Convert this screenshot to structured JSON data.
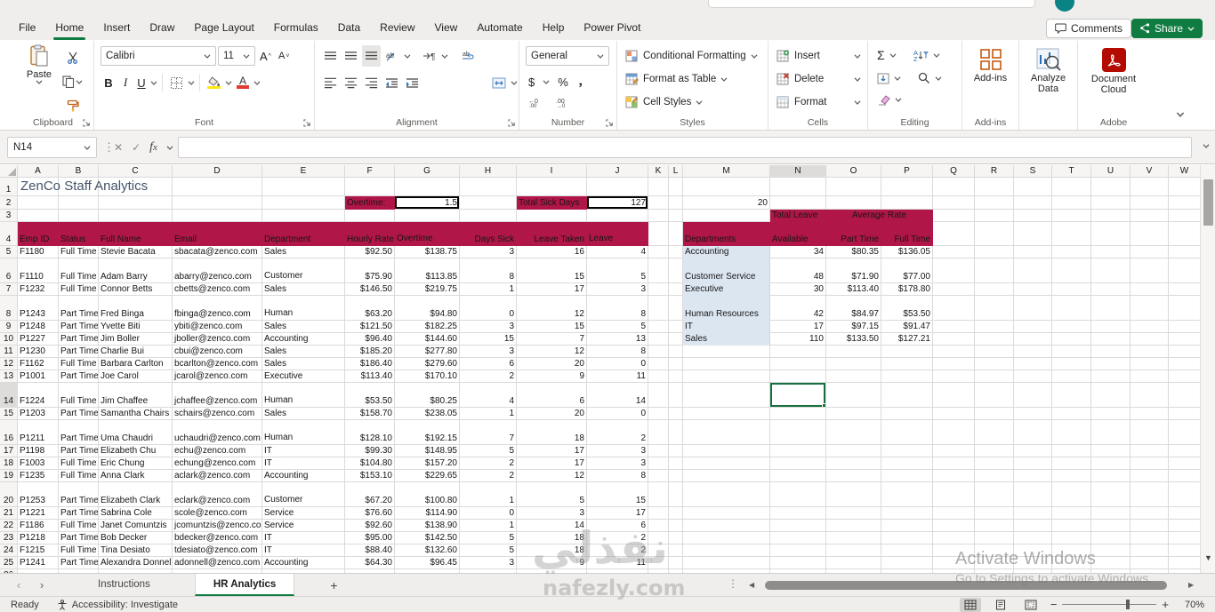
{
  "titlebar": {
    "avatar": "user-avatar"
  },
  "ribbon_tabs": {
    "items": [
      "File",
      "Home",
      "Insert",
      "Draw",
      "Page Layout",
      "Formulas",
      "Data",
      "Review",
      "View",
      "Automate",
      "Help",
      "Power Pivot"
    ],
    "active": "Home"
  },
  "actions": {
    "comments": "Comments",
    "share": "Share"
  },
  "ribbon": {
    "clipboard": {
      "label": "Clipboard",
      "paste": "Paste"
    },
    "font": {
      "label": "Font",
      "font_name": "Calibri",
      "font_size": "11"
    },
    "alignment": {
      "label": "Alignment"
    },
    "number": {
      "label": "Number",
      "format": "General"
    },
    "styles": {
      "label": "Styles",
      "items": [
        "Conditional Formatting",
        "Format as Table",
        "Cell Styles"
      ]
    },
    "cells": {
      "label": "Cells",
      "items": [
        "Insert",
        "Delete",
        "Format"
      ]
    },
    "editing": {
      "label": "Editing"
    },
    "addins": {
      "label": "Add-ins",
      "button": "Add-ins"
    },
    "analyze": {
      "button": "Analyze Data"
    },
    "adobe": {
      "label": "Adobe",
      "button": "Document Cloud"
    }
  },
  "formula_bar": {
    "name_box": "N14",
    "formula": ""
  },
  "sheet": {
    "columns": [
      "A",
      "B",
      "C",
      "D",
      "E",
      "F",
      "G",
      "H",
      "I",
      "J",
      "K",
      "L",
      "M",
      "N",
      "O",
      "P",
      "Q",
      "R",
      "S",
      "T",
      "U",
      "V",
      "W"
    ],
    "title": "ZenCo Staff Analytics",
    "overtime_label": "Overtime:",
    "overtime_value": "1.5",
    "sick_label": "Total Sick Days",
    "sick_value": "127",
    "m2_value": "20",
    "selected_cell": "N14",
    "table_headers": [
      {
        "col": "A",
        "label": "Emp ID",
        "align": "left"
      },
      {
        "col": "B",
        "label": "Status",
        "align": "left"
      },
      {
        "col": "C",
        "label": "Full Name",
        "align": "left"
      },
      {
        "col": "D",
        "label": "Email",
        "align": "left"
      },
      {
        "col": "E",
        "label": "Department",
        "align": "left"
      },
      {
        "col": "F",
        "label": "Hourly Rate",
        "align": "right"
      },
      {
        "col": "G",
        "label": "Overtime Rate",
        "align": "right",
        "wrap": true
      },
      {
        "col": "H",
        "label": "Days Sick",
        "align": "right"
      },
      {
        "col": "I",
        "label": "Leave Taken",
        "align": "right"
      },
      {
        "col": "J",
        "label": "Leave Available",
        "align": "right",
        "wrap": true
      }
    ],
    "employees": [
      {
        "emp_id": "F1180",
        "status": "Full Time",
        "full_name": "Stevie Bacata",
        "email": "sbacata@zenco.com",
        "department": "Sales",
        "hourly_rate": "$92.50",
        "overtime_rate": "$138.75",
        "days_sick": "3",
        "leave_taken": "16",
        "leave_available": "4"
      },
      {
        "emp_id": "F1110",
        "status": "Full Time",
        "full_name": "Adam Barry",
        "email": "abarry@zenco.com",
        "department": "Customer Service",
        "hourly_rate": "$75.90",
        "overtime_rate": "$113.85",
        "days_sick": "8",
        "leave_taken": "15",
        "leave_available": "5"
      },
      {
        "emp_id": "F1232",
        "status": "Full Time",
        "full_name": "Connor Betts",
        "email": "cbetts@zenco.com",
        "department": "Sales",
        "hourly_rate": "$146.50",
        "overtime_rate": "$219.75",
        "days_sick": "1",
        "leave_taken": "17",
        "leave_available": "3"
      },
      {
        "emp_id": "P1243",
        "status": "Part Time",
        "full_name": "Fred Binga",
        "email": "fbinga@zenco.com",
        "department": "Human Resources",
        "hourly_rate": "$63.20",
        "overtime_rate": "$94.80",
        "days_sick": "0",
        "leave_taken": "12",
        "leave_available": "8"
      },
      {
        "emp_id": "P1248",
        "status": "Part Time",
        "full_name": "Yvette Biti",
        "email": "ybiti@zenco.com",
        "department": "Sales",
        "hourly_rate": "$121.50",
        "overtime_rate": "$182.25",
        "days_sick": "3",
        "leave_taken": "15",
        "leave_available": "5"
      },
      {
        "emp_id": "P1227",
        "status": "Part Time",
        "full_name": "Jim Boller",
        "email": "jboller@zenco.com",
        "department": "Accounting",
        "hourly_rate": "$96.40",
        "overtime_rate": "$144.60",
        "days_sick": "15",
        "leave_taken": "7",
        "leave_available": "13"
      },
      {
        "emp_id": "P1230",
        "status": "Part Time",
        "full_name": "Charlie Bui",
        "email": "cbui@zenco.com",
        "department": "Sales",
        "hourly_rate": "$185.20",
        "overtime_rate": "$277.80",
        "days_sick": "3",
        "leave_taken": "12",
        "leave_available": "8"
      },
      {
        "emp_id": "F1162",
        "status": "Full Time",
        "full_name": "Barbara Carlton",
        "email": "bcarlton@zenco.com",
        "department": "Sales",
        "hourly_rate": "$186.40",
        "overtime_rate": "$279.60",
        "days_sick": "6",
        "leave_taken": "20",
        "leave_available": "0"
      },
      {
        "emp_id": "P1001",
        "status": "Part Time",
        "full_name": "Joe Carol",
        "email": "jcarol@zenco.com",
        "department": "Executive",
        "hourly_rate": "$113.40",
        "overtime_rate": "$170.10",
        "days_sick": "2",
        "leave_taken": "9",
        "leave_available": "11"
      },
      {
        "emp_id": "F1224",
        "status": "Full Time",
        "full_name": "Jim Chaffee",
        "email": "jchaffee@zenco.com",
        "department": "Human Resources",
        "hourly_rate": "$53.50",
        "overtime_rate": "$80.25",
        "days_sick": "4",
        "leave_taken": "6",
        "leave_available": "14"
      },
      {
        "emp_id": "P1203",
        "status": "Part Time",
        "full_name": "Samantha Chairs",
        "email": "schairs@zenco.com",
        "department": "Sales",
        "hourly_rate": "$158.70",
        "overtime_rate": "$238.05",
        "days_sick": "1",
        "leave_taken": "20",
        "leave_available": "0"
      },
      {
        "emp_id": "P1211",
        "status": "Part Time",
        "full_name": "Uma Chaudri",
        "email": "uchaudri@zenco.com",
        "department": "Human Resources",
        "hourly_rate": "$128.10",
        "overtime_rate": "$192.15",
        "days_sick": "7",
        "leave_taken": "18",
        "leave_available": "2"
      },
      {
        "emp_id": "P1198",
        "status": "Part Time",
        "full_name": "Elizabeth Chu",
        "email": "echu@zenco.com",
        "department": "IT",
        "hourly_rate": "$99.30",
        "overtime_rate": "$148.95",
        "days_sick": "5",
        "leave_taken": "17",
        "leave_available": "3"
      },
      {
        "emp_id": "F1003",
        "status": "Full Time",
        "full_name": "Eric Chung",
        "email": "echung@zenco.com",
        "department": "IT",
        "hourly_rate": "$104.80",
        "overtime_rate": "$157.20",
        "days_sick": "2",
        "leave_taken": "17",
        "leave_available": "3"
      },
      {
        "emp_id": "F1235",
        "status": "Full Time",
        "full_name": "Anna Clark",
        "email": "aclark@zenco.com",
        "department": "Accounting",
        "hourly_rate": "$153.10",
        "overtime_rate": "$229.65",
        "days_sick": "2",
        "leave_taken": "12",
        "leave_available": "8"
      },
      {
        "emp_id": "P1253",
        "status": "Part Time",
        "full_name": "Elizabeth Clark",
        "email": "eclark@zenco.com",
        "department": "Customer Service",
        "hourly_rate": "$67.20",
        "overtime_rate": "$100.80",
        "days_sick": "1",
        "leave_taken": "5",
        "leave_available": "15"
      },
      {
        "emp_id": "P1221",
        "status": "Part Time",
        "full_name": "Sabrina Cole",
        "email": "scole@zenco.com",
        "department": "Service",
        "hourly_rate": "$76.60",
        "overtime_rate": "$114.90",
        "days_sick": "0",
        "leave_taken": "3",
        "leave_available": "17"
      },
      {
        "emp_id": "F1186",
        "status": "Full Time",
        "full_name": "Janet Comuntzis",
        "email": "jcomuntzis@zenco.com",
        "department": "Service",
        "hourly_rate": "$92.60",
        "overtime_rate": "$138.90",
        "days_sick": "1",
        "leave_taken": "14",
        "leave_available": "6"
      },
      {
        "emp_id": "P1218",
        "status": "Part Time",
        "full_name": "Bob Decker",
        "email": "bdecker@zenco.com",
        "department": "IT",
        "hourly_rate": "$95.00",
        "overtime_rate": "$142.50",
        "days_sick": "5",
        "leave_taken": "18",
        "leave_available": "2"
      },
      {
        "emp_id": "F1215",
        "status": "Full Time",
        "full_name": "Tina Desiato",
        "email": "tdesiato@zenco.com",
        "department": "IT",
        "hourly_rate": "$88.40",
        "overtime_rate": "$132.60",
        "days_sick": "5",
        "leave_taken": "18",
        "leave_available": "2"
      },
      {
        "emp_id": "P1241",
        "status": "Part Time",
        "full_name": "Alexandra Donnell",
        "email": "adonnell@zenco.com",
        "department": "Accounting",
        "hourly_rate": "$64.30",
        "overtime_rate": "$96.45",
        "days_sick": "3",
        "leave_taken": "9",
        "leave_available": "11"
      }
    ],
    "summary": {
      "header_departments": "Departments",
      "header_total_leave": "Total Leave",
      "header_available": "Available",
      "header_avg_rate": "Average Rate",
      "header_part_time": "Part Time",
      "header_full_time": "Full Time",
      "rows": [
        {
          "department": "Accounting",
          "total_leave_available": "34",
          "part_time": "$80.35",
          "full_time": "$136.05"
        },
        {
          "department": "Customer Service",
          "total_leave_available": "48",
          "part_time": "$71.90",
          "full_time": "$77.00"
        },
        {
          "department": "Executive",
          "total_leave_available": "30",
          "part_time": "$113.40",
          "full_time": "$178.80"
        },
        {
          "department": "Human Resources",
          "total_leave_available": "42",
          "part_time": "$84.97",
          "full_time": "$53.50"
        },
        {
          "department": "IT",
          "total_leave_available": "17",
          "part_time": "$97.15",
          "full_time": "$91.47"
        },
        {
          "department": "Sales",
          "total_leave_available": "110",
          "part_time": "$133.50",
          "full_time": "$127.21"
        }
      ]
    }
  },
  "sheet_tabs": {
    "items": [
      "Instructions",
      "HR Analytics"
    ],
    "active": "HR Analytics"
  },
  "status_bar": {
    "mode": "Ready",
    "accessibility": "Accessibility: Investigate",
    "zoom": "70%"
  },
  "watermark": {
    "line1": "Activate Windows",
    "line2": "Go to Settings to activate Windows."
  },
  "site_watermark": {
    "arabic": "نفذلي",
    "domain": "nafezly.com"
  },
  "colors": {
    "accent_green": "#107c41",
    "header_red": "#b01648",
    "dept_blue": "#dce6f1"
  }
}
